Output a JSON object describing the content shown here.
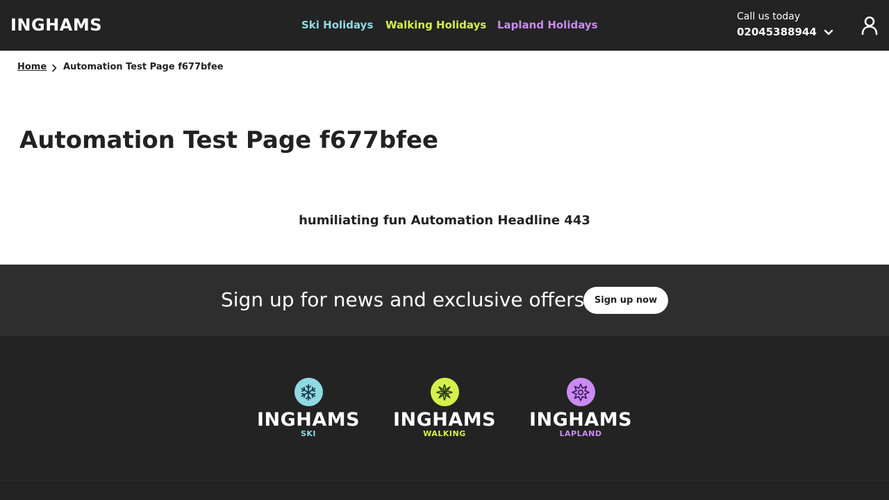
{
  "header": {
    "logo": "INGHAMS",
    "nav": [
      {
        "label": "Ski Holidays",
        "color": "#8fd9e4"
      },
      {
        "label": "Walking Holidays",
        "color": "#d5f04a"
      },
      {
        "label": "Lapland Holidays",
        "color": "#c98bf2"
      }
    ],
    "call_label": "Call us today",
    "phone": "02045388944",
    "icons": [
      "chevron-down-icon",
      "user-icon"
    ]
  },
  "breadcrumb": {
    "home": "Home",
    "current": "Automation Test Page f677bfee"
  },
  "main": {
    "title": "Automation Test Page f677bfee",
    "headline": "humiliating fun Automation Headline 443"
  },
  "signup": {
    "text": "Sign up for news and exclusive offers",
    "button": "Sign up now"
  },
  "footer": {
    "brands": [
      {
        "name": "INGHAMS",
        "sub": "SKI",
        "color": "#8fd9e4",
        "icon": "snowflake-icon"
      },
      {
        "name": "INGHAMS",
        "sub": "WALKING",
        "color": "#d5f04a",
        "icon": "flower-icon"
      },
      {
        "name": "INGHAMS",
        "sub": "LAPLAND",
        "color": "#c98bf2",
        "icon": "star-icon"
      }
    ]
  }
}
